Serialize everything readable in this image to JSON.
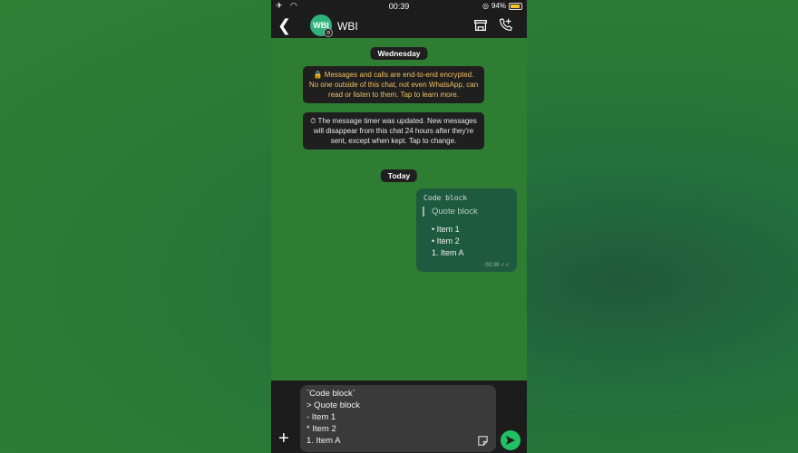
{
  "status_bar": {
    "time": "00:39",
    "battery": "94%",
    "battery_level": 0.94
  },
  "header": {
    "contact_name": "WBI",
    "avatar_text": "WBI"
  },
  "chat": {
    "day_labels": [
      "Wednesday",
      "Today"
    ],
    "system_messages": [
      "🔒 Messages and calls are end-to-end encrypted. No one outside of this chat, not even WhatsApp, can read or listen to them. Tap to learn more.",
      "⏱ The message timer was updated. New messages will disappear from this chat 24 hours after they're sent, except when kept. Tap to change."
    ],
    "message": {
      "code": "Code block",
      "quote": "Quote block",
      "items": [
        "•  Item 1",
        "•  Item 2",
        "1. Item A"
      ],
      "time": "00:39"
    }
  },
  "composer": {
    "lines": [
      "`Code block`",
      "> Quote block",
      "- Item 1",
      "* Item 2",
      "1. Item A"
    ]
  },
  "colors": {
    "accent": "#21c063",
    "bubble": "#1e5a40",
    "chat_bg": "#2f7d33",
    "warning_text": "#f0c060"
  },
  "icons": [
    "airplane-icon",
    "wifi-icon",
    "back-icon",
    "store-icon",
    "add-call-icon",
    "lock-icon",
    "timer-icon",
    "check-icon",
    "plus-icon",
    "sticker-icon",
    "send-icon"
  ]
}
